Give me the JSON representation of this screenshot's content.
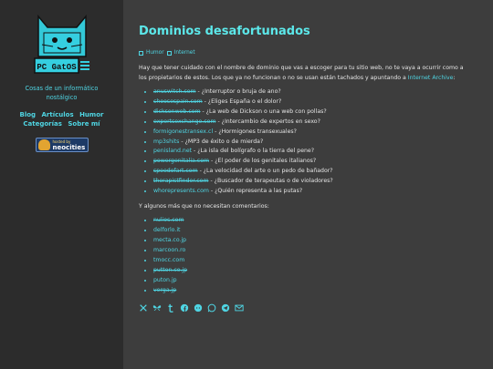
{
  "site": {
    "logo_text": "PC GatOS",
    "tagline": "Cosas de un informático nostálgico",
    "nav": [
      "Blog",
      "Artículos",
      "Humor",
      "Categorías",
      "Sobre mí"
    ],
    "badge": {
      "small": "hosted by",
      "big": "neocities"
    }
  },
  "post": {
    "title": "Dominios desafortunados",
    "tags": [
      "Humor",
      "Internet"
    ],
    "intro_before": "Hay que tener cuidado con el nombre de dominio que vas a escoger para tu sitio web, no te vaya a ocurrir como a los propietarios de estos. Los que ya no funcionan o no se usan están tachados y apuntando a ",
    "intro_link": "Internet Archive",
    "intro_after": ":",
    "domains": [
      {
        "domain": "anuswitch.com",
        "comment": " - ¿Interruptor o bruja de ano?",
        "struck": true
      },
      {
        "domain": "choosespain.com",
        "comment": " - ¿Eliges España o el dolor?",
        "struck": true
      },
      {
        "domain": "dicksonweb.com",
        "comment": " - ¿La web de Dickson o una web con pollas?",
        "struck": true
      },
      {
        "domain": "expertsexchange.com",
        "comment": " - ¿Intercambio de expertos en sexo?",
        "struck": true
      },
      {
        "domain": "formigonestransex.cl",
        "comment": " - ¿Hormigones transexuales?",
        "struck": false
      },
      {
        "domain": "mp3shits",
        "comment": " - ¿MP3 de éxito o de mierda?",
        "struck": false
      },
      {
        "domain": "penisland.net",
        "comment": " - ¿La isla del bolígrafo o la tierra del pene?",
        "struck": false
      },
      {
        "domain": "powergenitalia.com",
        "comment": " - ¿El poder de los genitales italianos?",
        "struck": true
      },
      {
        "domain": "speedofart.com",
        "comment": " - ¿La velocidad del arte o un pedo de bañador?",
        "struck": true
      },
      {
        "domain": "therapistfinder.com",
        "comment": " - ¿Buscador de terapeutas o de violadores?",
        "struck": true
      },
      {
        "domain": "whorepresents.com",
        "comment": " - ¿Quién representa a las putas?",
        "struck": false
      }
    ],
    "more_text": "Y algunos más que no necesitan comentarios:",
    "more_domains": [
      {
        "domain": "nulios.com",
        "struck": true
      },
      {
        "domain": "delforlo.it",
        "struck": false
      },
      {
        "domain": "mecta.co.jp",
        "struck": false
      },
      {
        "domain": "marcoon.ro",
        "struck": false
      },
      {
        "domain": "tmocc.com",
        "struck": false
      },
      {
        "domain": "putton.co.jp",
        "struck": true
      },
      {
        "domain": "puton.jp",
        "struck": false
      },
      {
        "domain": "verga.jp",
        "struck": true
      }
    ],
    "share_icons": [
      "x-icon",
      "bluesky-icon",
      "tumblr-icon",
      "facebook-icon",
      "reddit-icon",
      "whatsapp-icon",
      "telegram-icon",
      "email-icon"
    ]
  },
  "colors": {
    "accent": "#4fd5e3",
    "title": "#5ce8ea",
    "sidebar": "#2c2c2c",
    "main": "#3d3d3d"
  }
}
